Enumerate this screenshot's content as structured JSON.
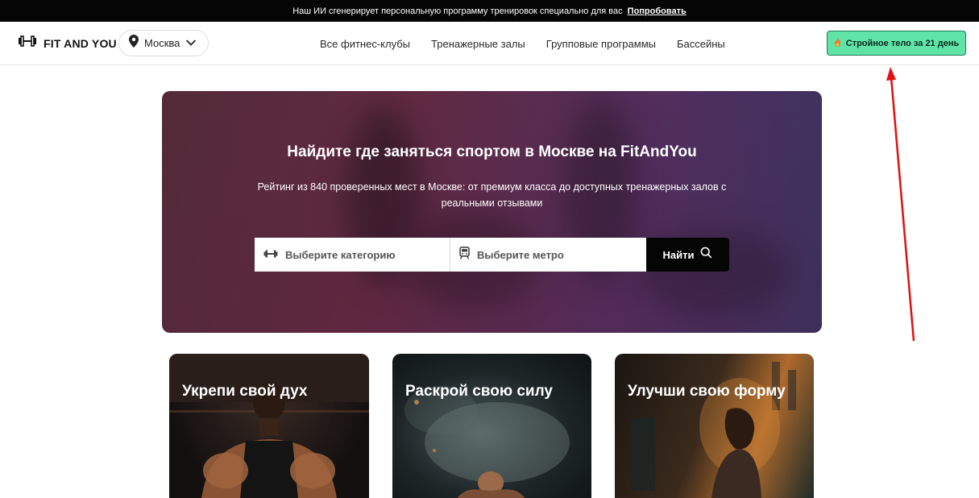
{
  "promo": {
    "text": "Наш ИИ сгенерирует персональную программу тренировок специально для вас",
    "link": "Попробовать"
  },
  "header": {
    "logo_text": "FIT AND YOU",
    "city": "Москва",
    "nav": [
      "Все фитнес-клубы",
      "Тренажерные залы",
      "Групповые программы",
      "Бассейны"
    ],
    "cta_label": "Стройное тело за 21 день"
  },
  "hero": {
    "title": "Найдите где заняться спортом в Москве на FitAndYou",
    "subtitle": "Рейтинг из 840 проверенных мест в Москве: от премиум класса до доступных тренажерных залов с реальными отзывами",
    "category_placeholder": "Выберите категорию",
    "metro_placeholder": "Выберите метро",
    "find_label": "Найти"
  },
  "cards": [
    {
      "title": "Укрепи свой дух"
    },
    {
      "title": "Раскрой свою силу"
    },
    {
      "title": "Улучши свою форму"
    }
  ],
  "colors": {
    "cta_bg": "#5fe3a6",
    "annotation_arrow": "#e01010",
    "promo_bg": "#050505"
  },
  "icons": {
    "logo": "dumbbell-icon",
    "city": "location-pin-icon",
    "city_dropdown": "chevron-down-icon",
    "cta": "fire-icon",
    "category": "dumbbell-icon",
    "metro": "train-icon",
    "find": "search-icon"
  }
}
